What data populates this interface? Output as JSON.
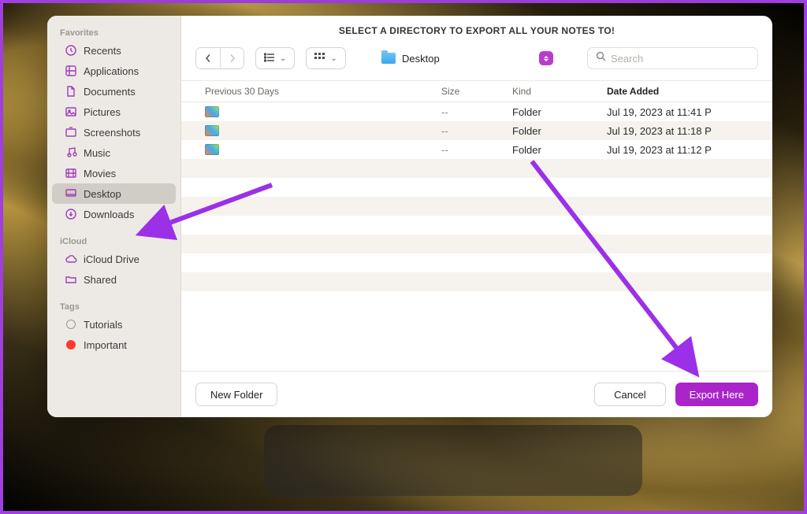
{
  "dialog": {
    "title": "SELECT A DIRECTORY TO EXPORT ALL YOUR NOTES TO!",
    "location_label": "Desktop",
    "search_placeholder": "Search",
    "group_label": "Previous 30 Days",
    "columns": {
      "size": "Size",
      "kind": "Kind",
      "date": "Date Added"
    },
    "new_folder": "New Folder",
    "cancel": "Cancel",
    "confirm": "Export Here"
  },
  "sidebar": {
    "favorites_label": "Favorites",
    "icloud_label": "iCloud",
    "tags_label": "Tags",
    "favorites": [
      {
        "id": "recents",
        "label": "Recents"
      },
      {
        "id": "applications",
        "label": "Applications"
      },
      {
        "id": "documents",
        "label": "Documents"
      },
      {
        "id": "pictures",
        "label": "Pictures"
      },
      {
        "id": "screenshots",
        "label": "Screenshots"
      },
      {
        "id": "music",
        "label": "Music"
      },
      {
        "id": "movies",
        "label": "Movies"
      },
      {
        "id": "desktop",
        "label": "Desktop"
      },
      {
        "id": "downloads",
        "label": "Downloads"
      }
    ],
    "icloud": [
      {
        "id": "icloud-drive",
        "label": "iCloud Drive"
      },
      {
        "id": "shared",
        "label": "Shared"
      }
    ],
    "tags": [
      {
        "id": "tutorials",
        "label": "Tutorials",
        "color": "transparent",
        "border": "#9b9793"
      },
      {
        "id": "important",
        "label": "Important",
        "color": "#ff3b30",
        "border": "#ff3b30"
      }
    ]
  },
  "rows": [
    {
      "size": "--",
      "kind": "Folder",
      "date": "Jul 19, 2023 at 11:41 P"
    },
    {
      "size": "--",
      "kind": "Folder",
      "date": "Jul 19, 2023 at 11:18 P"
    },
    {
      "size": "--",
      "kind": "Folder",
      "date": "Jul 19, 2023 at 11:12 P"
    }
  ]
}
